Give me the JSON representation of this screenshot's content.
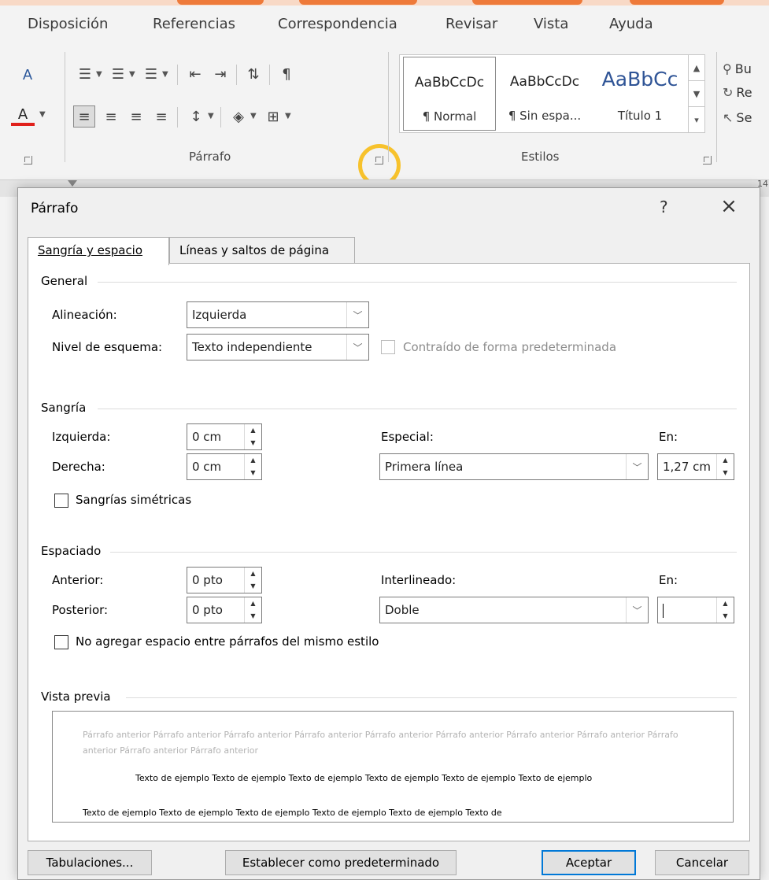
{
  "ribbon": {
    "tabs": [
      "Disposición",
      "Referencias",
      "Correspondencia",
      "Revisar",
      "Vista",
      "Ayuda"
    ],
    "paragraph_group_label": "Párrafo",
    "styles_group_label": "Estilos",
    "styles": [
      {
        "sample": "AaBbCcDc",
        "name": "¶ Normal"
      },
      {
        "sample": "AaBbCcDc",
        "name": "¶ Sin espa..."
      },
      {
        "sample": "AaBbCc",
        "name": "Título 1"
      }
    ],
    "editing": [
      "Bu",
      "Re",
      "Se"
    ],
    "pilcrow": "¶",
    "ruler_numbers": [
      "14"
    ]
  },
  "dialog": {
    "title": "Párrafo",
    "help": "?",
    "close": "×",
    "tabs": [
      "Sangría y espacio",
      "Líneas y saltos de página"
    ],
    "general": {
      "heading": "General",
      "alignment_label": "Alineación:",
      "alignment_value": "Izquierda",
      "outline_label": "Nivel de esquema:",
      "outline_value": "Texto independiente",
      "collapsed_label": "Contraído de forma predeterminada"
    },
    "indent": {
      "heading": "Sangría",
      "left_label": "Izquierda:",
      "left_value": "0 cm",
      "right_label": "Derecha:",
      "right_value": "0 cm",
      "special_label": "Especial:",
      "special_value": "Primera línea",
      "by_label": "En:",
      "by_value": "1,27 cm",
      "mirror_label": "Sangrías simétricas"
    },
    "spacing": {
      "heading": "Espaciado",
      "before_label": "Anterior:",
      "before_value": "0 pto",
      "after_label": "Posterior:",
      "after_value": "0 pto",
      "line_label": "Interlineado:",
      "line_value": "Doble",
      "at_label": "En:",
      "no_space_label": "No agregar espacio entre párrafos del mismo estilo"
    },
    "preview": {
      "heading": "Vista previa",
      "previous_text": "Párrafo anterior Párrafo anterior Párrafo anterior Párrafo anterior Párrafo anterior Párrafo anterior Párrafo anterior Párrafo anterior Párrafo anterior Párrafo anterior Párrafo anterior",
      "sample_line1": "Texto de ejemplo Texto de ejemplo Texto de ejemplo Texto de ejemplo Texto de ejemplo Texto de ejemplo",
      "sample_line2": "Texto de ejemplo Texto de ejemplo Texto de ejemplo Texto de ejemplo Texto de ejemplo Texto de"
    },
    "buttons": {
      "tabs": "Tabulaciones...",
      "set_default": "Establecer como predeterminado",
      "ok": "Aceptar",
      "cancel": "Cancelar"
    }
  }
}
